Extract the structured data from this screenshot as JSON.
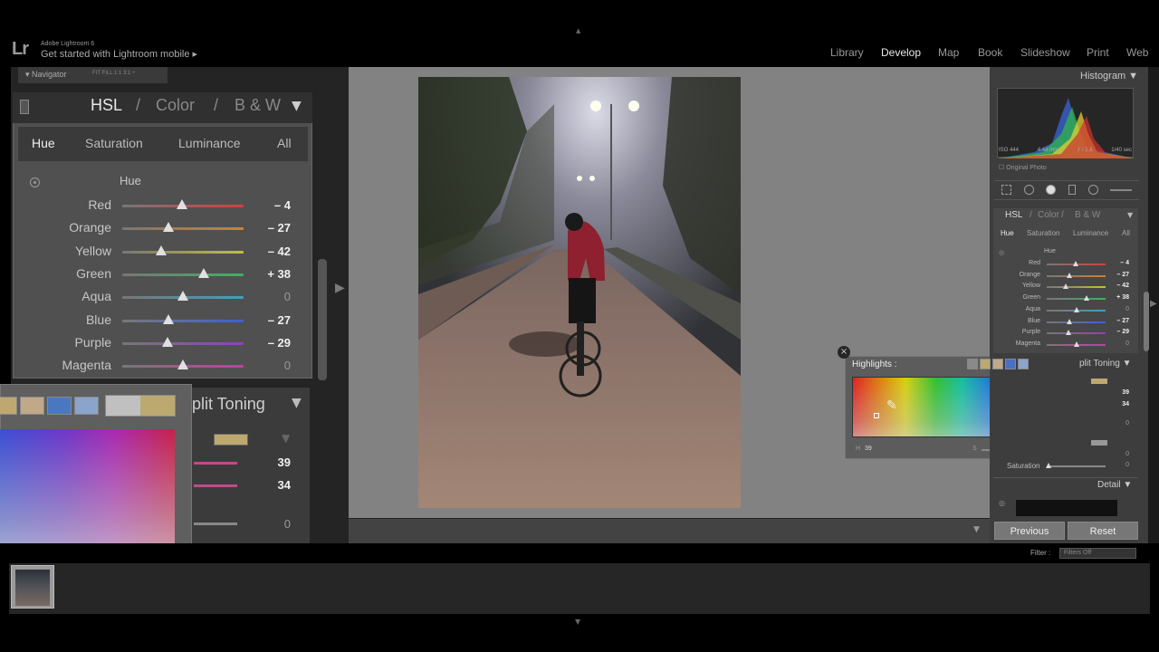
{
  "app": {
    "logo": "Lr",
    "name": "Adobe Lightroom 6",
    "tagline": "Get started with Lightroom mobile ▸",
    "modules": [
      "Library",
      "Develop",
      "Map",
      "Book",
      "Slideshow",
      "Print",
      "Web"
    ],
    "active_module": "Develop"
  },
  "navigator": {
    "label": "Navigator",
    "options": "FIT   FILL   1:1   3:1 ÷"
  },
  "hsl_panel": {
    "heads": [
      "HSL",
      "/",
      "Color",
      "/",
      "B & W"
    ],
    "tabs": [
      "Hue",
      "Saturation",
      "Luminance",
      "All"
    ],
    "active_tab": "Hue",
    "subheading": "Hue",
    "rows": [
      {
        "label": "Red",
        "value": "– 4",
        "level": 0.49,
        "zero": false,
        "track": "#d04040"
      },
      {
        "label": "Orange",
        "value": "– 27",
        "level": 0.38,
        "zero": false,
        "track": "#d08030"
      },
      {
        "label": "Yellow",
        "value": "– 42",
        "level": 0.32,
        "zero": false,
        "track": "#c0c040"
      },
      {
        "label": "Green",
        "value": "+ 38",
        "level": 0.67,
        "zero": false,
        "track": "#40b060"
      },
      {
        "label": "Aqua",
        "value": "0",
        "level": 0.5,
        "zero": true,
        "track": "#40a0c0"
      },
      {
        "label": "Blue",
        "value": "– 27",
        "level": 0.38,
        "zero": false,
        "track": "#4060d0"
      },
      {
        "label": "Purple",
        "value": "– 29",
        "level": 0.37,
        "zero": false,
        "track": "#9040c0"
      },
      {
        "label": "Magenta",
        "value": "0",
        "level": 0.5,
        "zero": true,
        "track": "#c040a0"
      }
    ]
  },
  "split_toning": {
    "title": "plit Toning",
    "values": [
      "39",
      "34",
      "0"
    ]
  },
  "color_picker": {
    "swatches": [
      "#bfa870",
      "#c0a888",
      "#4a78c0",
      "#8aa4cc"
    ]
  },
  "right_panel": {
    "histogram_label": "Histogram",
    "hist_info": [
      "ISO 444",
      "4.44 mm",
      "ƒ / 1.8",
      "1/40 sec"
    ],
    "original_photo": "Original Photo",
    "hsl_heads": [
      "HSL",
      "/",
      "Color",
      "/",
      "B & W"
    ],
    "tabs": [
      "Hue",
      "Saturation",
      "Luminance",
      "All"
    ],
    "active_tab": "Hue",
    "subheading": "Hue",
    "rows": [
      {
        "label": "Red",
        "value": "– 4",
        "level": 0.49,
        "zero": false,
        "track": "#d04040"
      },
      {
        "label": "Orange",
        "value": "– 27",
        "level": 0.38,
        "zero": false,
        "track": "#d08030"
      },
      {
        "label": "Yellow",
        "value": "– 42",
        "level": 0.32,
        "zero": false,
        "track": "#c0c040"
      },
      {
        "label": "Green",
        "value": "+ 38",
        "level": 0.67,
        "zero": false,
        "track": "#40b060"
      },
      {
        "label": "Aqua",
        "value": "0",
        "level": 0.5,
        "zero": true,
        "track": "#40a0c0"
      },
      {
        "label": "Blue",
        "value": "– 27",
        "level": 0.38,
        "zero": false,
        "track": "#4060d0"
      },
      {
        "label": "Purple",
        "value": "– 29",
        "level": 0.37,
        "zero": false,
        "track": "#9040c0"
      },
      {
        "label": "Magenta",
        "value": "0",
        "level": 0.5,
        "zero": true,
        "track": "#c040a0"
      }
    ],
    "split_title": "plit Toning",
    "split_values": [
      "39",
      "34",
      "0",
      "0",
      "0"
    ],
    "saturation_label": "Saturation",
    "detail_label": "Detail",
    "previous": "Previous",
    "reset": "Reset"
  },
  "highlights_popover": {
    "title": "Highlights :",
    "hue_value": "39",
    "sat_value": "34",
    "hue_letter": "H",
    "sat_letter": "S",
    "sat_level": 0.34,
    "swatches": [
      "#8a8a8a",
      "#bca970",
      "#c0a888",
      "#4a70c0",
      "#8aa4cc"
    ]
  },
  "filmstrip": {
    "filter_label": "Filter :",
    "filter_value": "Filters Off"
  }
}
